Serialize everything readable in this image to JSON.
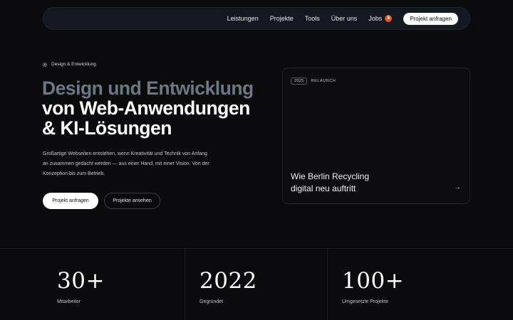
{
  "nav": {
    "links": [
      "Leistungen",
      "Projekte",
      "Tools",
      "Über uns",
      "Jobs"
    ],
    "jobs_badge": "6",
    "cta": "Projekt anfragen"
  },
  "hero": {
    "eyebrow": "Design & Entwicklung",
    "headline_line1": "Design und Entwicklung",
    "headline_line2": "von Web-Anwendungen",
    "headline_line3": "& KI-Lösungen",
    "intro": "Großartige Webseiten entstehen, wenn Kreativität und Technik von Anfang an zusammen gedacht werden — aus einer Hand, mit einer Vision. Von der Konzeption bis zum Betrieb.",
    "primary_button": "Projekt anfragen",
    "secondary_button": "Projekte ansehen"
  },
  "case": {
    "year": "2025",
    "tag": "RELAUNCH",
    "title_line1": "Wie Berlin Recycling",
    "title_line2": "digital neu auftritt",
    "arrow": "→"
  },
  "stats": [
    {
      "value": "30+",
      "label": "Mitarbeiter"
    },
    {
      "value": "2022",
      "label": "Gegründet"
    },
    {
      "value": "100+",
      "label": "Umgesetzte Projekte"
    }
  ],
  "colors": {
    "background": "#0b0b0d",
    "nav_background": "#141820",
    "headline_muted": "#6f7684",
    "badge": "#e8552b"
  }
}
